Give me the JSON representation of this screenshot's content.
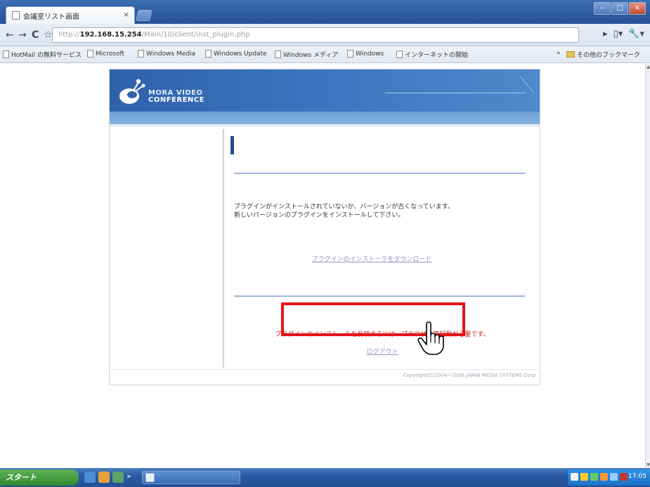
{
  "tab": {
    "title": "会議室リスト画面",
    "close": "×"
  },
  "window": {
    "minimize": "–",
    "maximize": "□",
    "close": "×"
  },
  "toolbar": {
    "back": "←",
    "forward": "→",
    "reload": "C",
    "star": "☆",
    "url_scheme": "http://",
    "url_host": "192.168.15.254",
    "url_path": "/Main/10/client/inst_plugin.php",
    "page_menu": "▸",
    "doc_menu": "▯▾",
    "tools_menu": "🔧▾"
  },
  "bookmarks": [
    "HotMail の無料サービス",
    "Microsoft",
    "Windows Media",
    "Windows Update",
    "Windows メディア",
    "Windows",
    "インターネットの開始"
  ],
  "bookmarks_more": "»",
  "other_bookmarks": "その他のブックマーク",
  "page": {
    "brand_line1": "MORA VIDEO",
    "brand_line2": "CONFERENCE",
    "message_line1": "プラグインがインストールされていないか、バージョンが古くなっています。",
    "message_line2": "新しいバージョンのプラグインをインストールして下さい。",
    "download_link": "プラグインのインストーラをダウンロード",
    "warning": "プラグインのインストールを反映するには、ブラウザの再起動が必要です。",
    "logout": "ログアウト",
    "copyright": "Copyright(C)2004～2006 JAPAN MEDIA SYSTEMS Corp."
  },
  "taskbar": {
    "start_label": "スタート",
    "quick_more": "»",
    "clock": "17:05"
  },
  "colors": {
    "highlight_box": "#e5141a",
    "warning_text": "#cc1f1f",
    "banner_blue": "#2f62aa",
    "link": "#9b8fc8"
  }
}
